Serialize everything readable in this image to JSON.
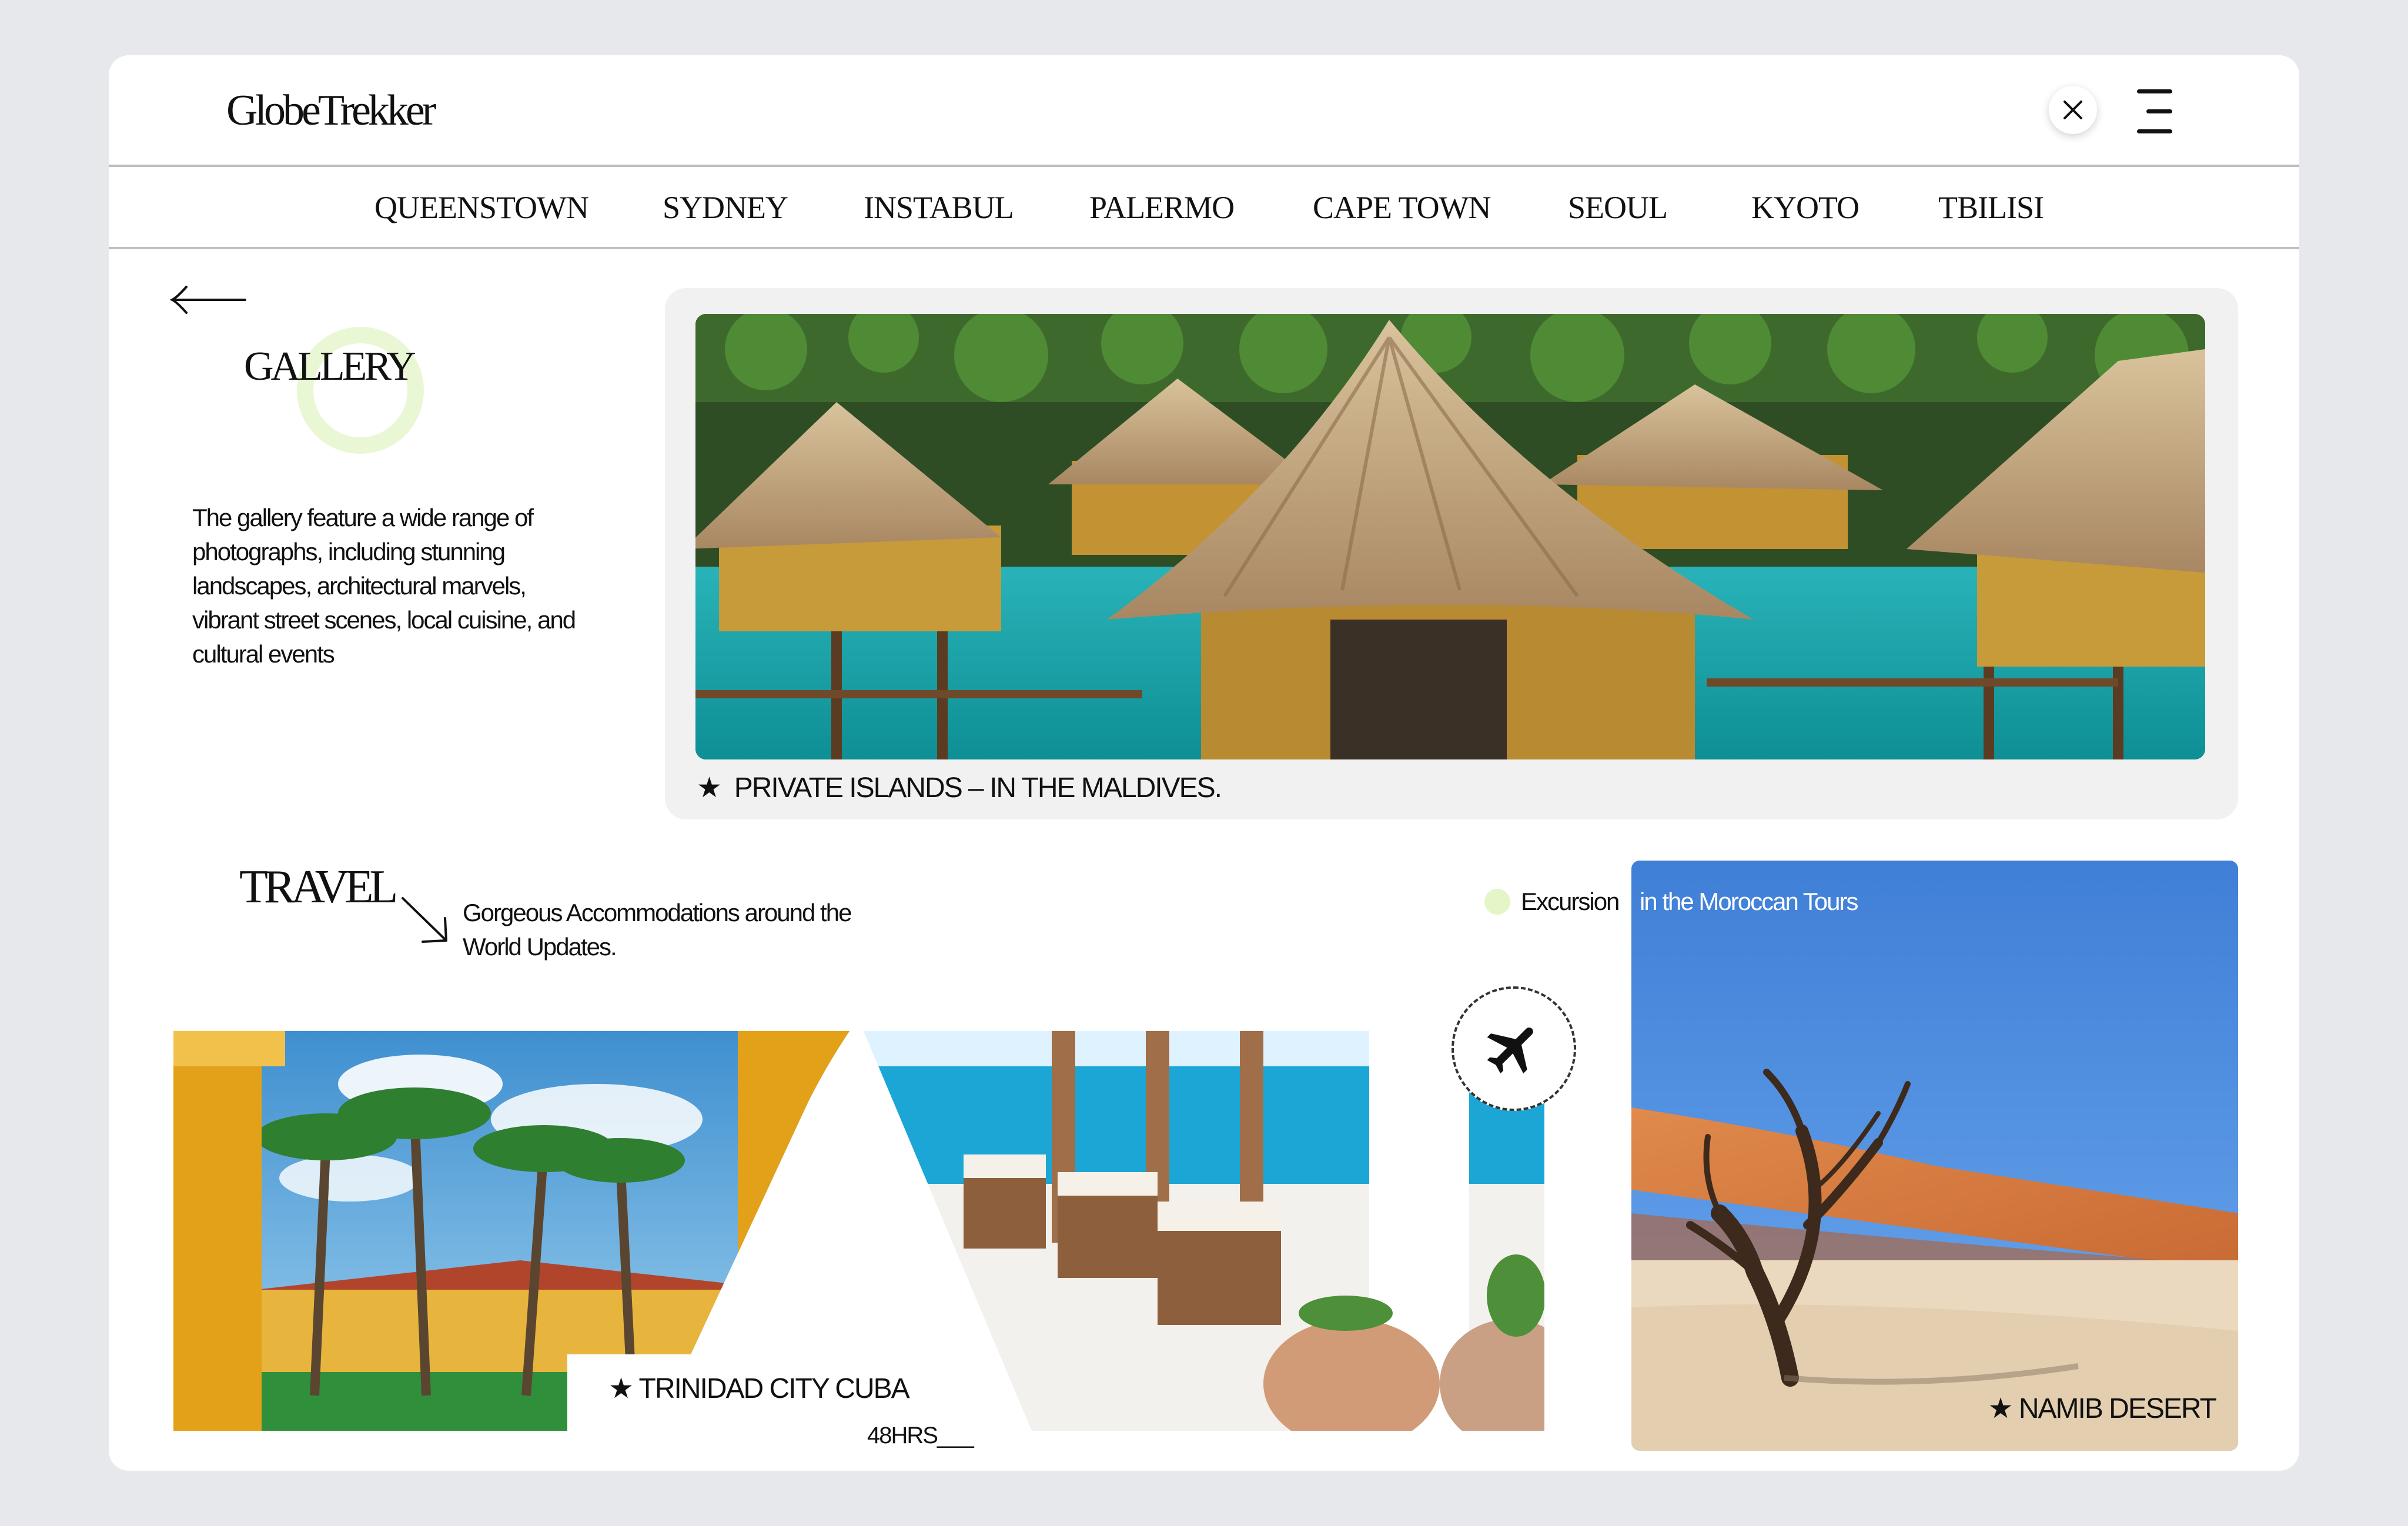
{
  "header": {
    "logo": "GlobeTrekker",
    "close_icon": "close-icon",
    "menu_icon": "menu-icon"
  },
  "cities": [
    "QUEENSTOWN",
    "SYDNEY",
    "INSTABUL",
    "PALERMO",
    "CAPE TOWN",
    "SEOUL",
    "KYOTO",
    "TBILISI"
  ],
  "gallery": {
    "title": "GALLERY",
    "description": "The gallery feature a wide range of photographs, including stunning landscapes, architectural marvels, vibrant street scenes, local cuisine, and cultural events",
    "hero_caption": "PRIVATE ISLANDS –  IN THE MALDIVES."
  },
  "travel": {
    "title": "TRAVEL",
    "subtitle": "Gorgeous Accommodations around the World Updates.",
    "excursion_label": "Excursion",
    "excursion_sub": "in the Moroccan Tours",
    "cuba_label": "TRINIDAD CITY CUBA",
    "hrs_label": "48HRS___",
    "desert_label": "NAMIB DESERT"
  },
  "colors": {
    "accent_green": "#e4f5c8",
    "background": "#e6e8ec"
  }
}
